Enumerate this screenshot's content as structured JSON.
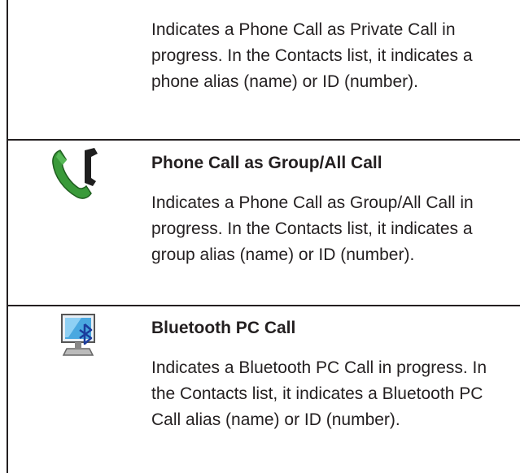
{
  "rows": [
    {
      "title": "",
      "description": "Indicates a Phone Call as Private Call in progress. In the Contacts list, it indicates a phone alias (name) or ID (number).",
      "icon": null
    },
    {
      "title": "Phone Call as Group/All Call",
      "description": "Indicates a Phone Call as Group/All Call in progress. In the Contacts list, it indicates a group alias (name) or ID (number).",
      "icon": "phone-call-group-icon"
    },
    {
      "title": "Bluetooth PC Call",
      "description": "Indicates a Bluetooth PC Call in progress. In the Contacts list, it indicates a Bluetooth PC Call alias (name) or ID (number).",
      "icon": "bluetooth-pc-call-icon"
    }
  ],
  "colors": {
    "text": "#231f20",
    "rule": "#231f20",
    "phone_green": "#3a9a3a",
    "phone_dark": "#1f1f1f",
    "screen_blue": "#4aa8e0",
    "bluetooth_blue": "#1b3c9c"
  }
}
